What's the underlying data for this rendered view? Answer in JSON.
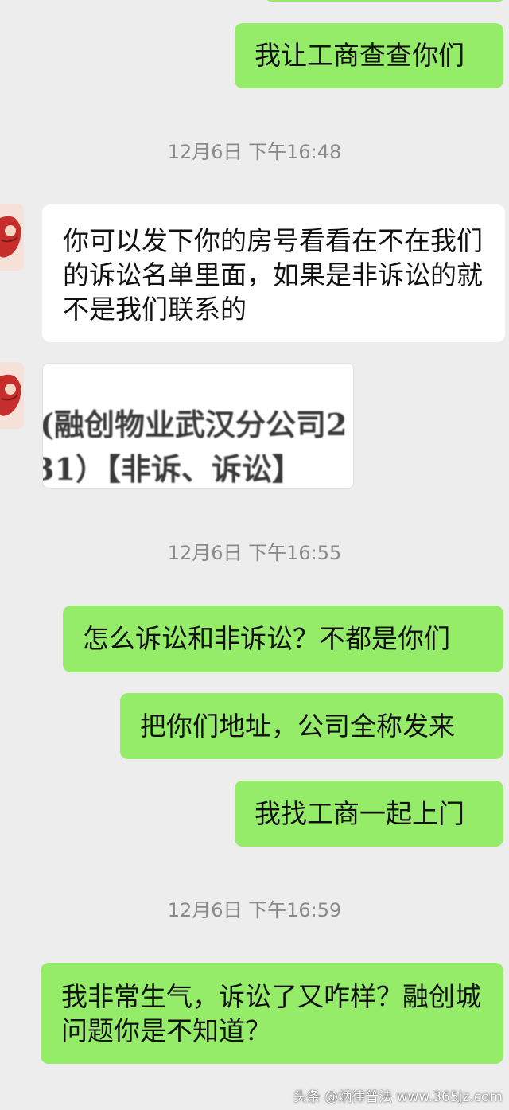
{
  "messages": [
    {
      "text": "我让工商查查你们"
    },
    {
      "text": "你可以发下你的房号看看在不在我们的诉讼名单里面，如果是非诉讼的就不是我们联系的"
    },
    {
      "text": "怎么诉讼和非诉讼？不都是你们"
    },
    {
      "text": "把你们地址，公司全称发来"
    },
    {
      "text": "我找工商一起上门"
    },
    {
      "text": "我非常生气，诉讼了又咋样？融创城问题你是不知道？"
    }
  ],
  "timestamps": {
    "t1": "12月6日 下午16:48",
    "t2": "12月6日 下午16:55",
    "t3": "12月6日 下午16:59"
  },
  "image_message": {
    "line1": "(融创物业武汉分公司2",
    "line2": "31）【非诉、诉讼】"
  },
  "watermark": "头条 @炳律普法 www.365jz.com",
  "colors": {
    "background": "#ededed",
    "sent_bubble": "#95ec69",
    "received_bubble": "#ffffff",
    "timestamp": "#8a8a8a"
  },
  "icons": {
    "avatar": "contact-avatar-icon"
  }
}
